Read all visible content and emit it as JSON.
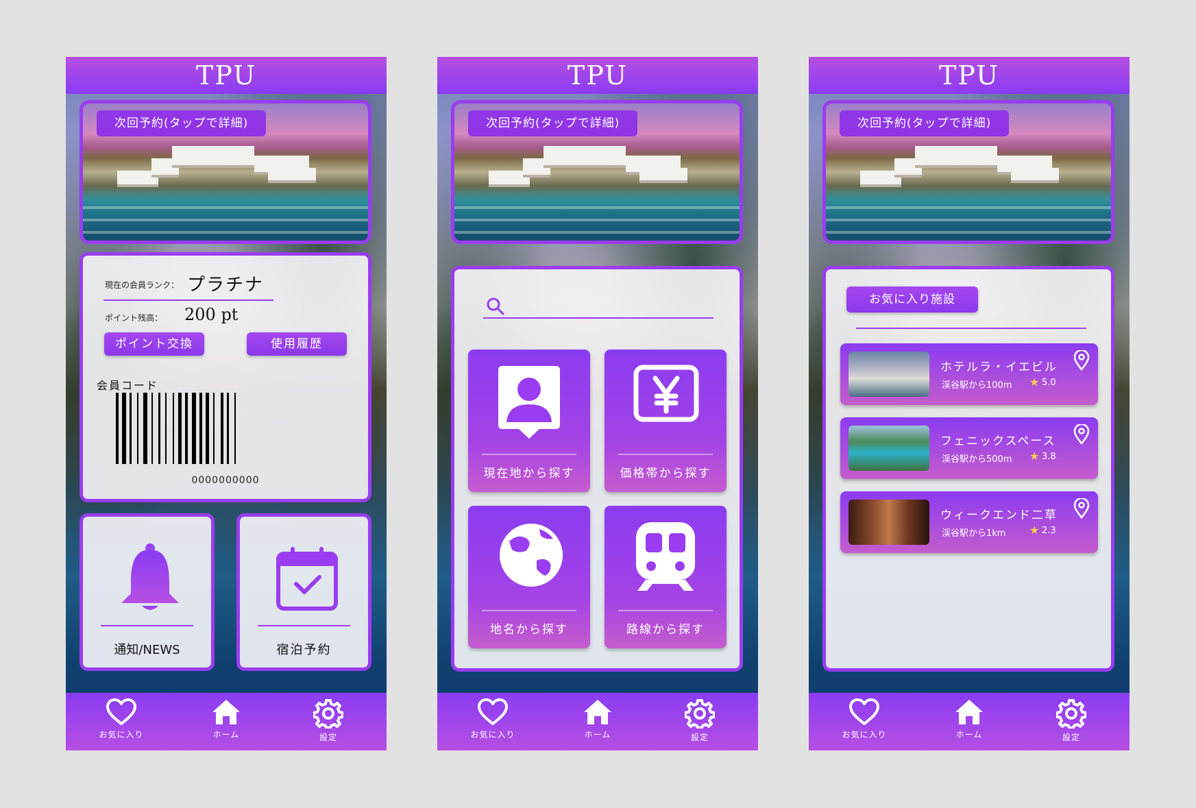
{
  "app": {
    "title": "TPU"
  },
  "hero": {
    "label": "次回予約(タップで詳細)"
  },
  "nav": {
    "favorites": "お気に入り",
    "home": "ホーム",
    "settings": "設定"
  },
  "screen1": {
    "rank_label": "現在の会員ランク：",
    "rank_value": "プラチナ",
    "points_label": "ポイント残高：",
    "points_value": "200 pt",
    "exchange_button": "ポイント交換",
    "history_button": "使用履歴",
    "member_code_label": "会員コード",
    "barcode_number": "0000000000",
    "news_label": "通知/NEWS",
    "booking_label": "宿泊予約"
  },
  "screen2": {
    "search": {
      "value": "",
      "placeholder": ""
    },
    "tiles": [
      {
        "label": "現在地から探す",
        "icon": "location-person-icon"
      },
      {
        "label": "価格帯から探す",
        "icon": "yen-icon"
      },
      {
        "label": "地名から探す",
        "icon": "globe-icon"
      },
      {
        "label": "路線から探す",
        "icon": "train-icon"
      }
    ]
  },
  "screen3": {
    "section_title": "お気に入り施設",
    "favorites": [
      {
        "name": "ホテルラ・イエビル",
        "distance": "渓谷駅から100m",
        "rating": "5.0"
      },
      {
        "name": "フェニックスペース",
        "distance": "渓谷駅から500m",
        "rating": "3.8"
      },
      {
        "name": "ウィークエンド二草",
        "distance": "渓谷駅から1km",
        "rating": "2.3"
      }
    ]
  },
  "colors": {
    "accent": "#8a3cf2",
    "accent_light": "#b64fe3",
    "card_bg": "#f7f6fa",
    "star": "#f4d24a"
  }
}
